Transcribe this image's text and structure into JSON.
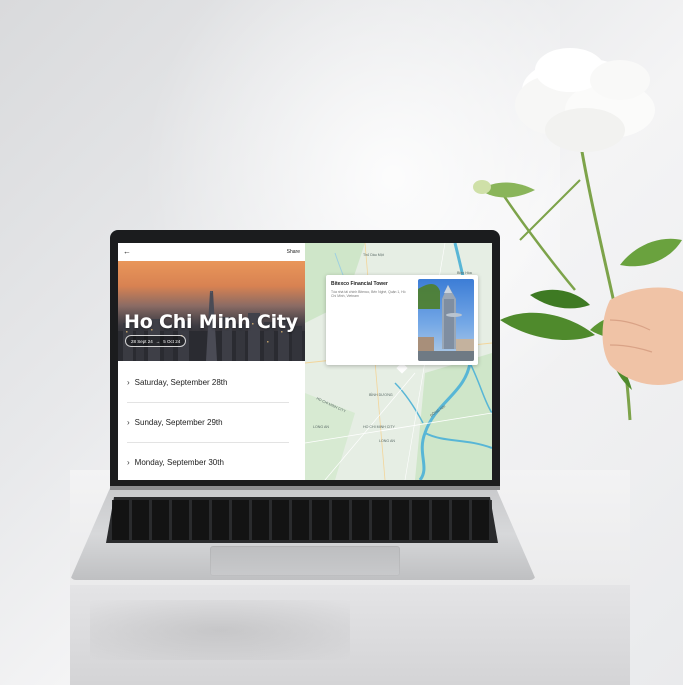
{
  "app": {
    "back_icon": "arrow-left-icon",
    "share_label": "Share",
    "city_title": "Ho Chi Minh City",
    "date_range": {
      "start": "28 Sept 24",
      "arrow": "→",
      "end": "5 Oct 24"
    },
    "days": [
      {
        "label": "Saturday, September 28th"
      },
      {
        "label": "Sunday, September 29th"
      },
      {
        "label": "Monday, September 30th"
      }
    ],
    "map": {
      "labels": {
        "thu_dau_mot": "Thủ Dầu Một",
        "bien_hoa": "Biên Hòa",
        "binh_duong": "BÌNH DƯƠNG",
        "ho_chi_minh_city": "HO CHI MINH CITY",
        "long_an": "LONG AN",
        "dong_nai": "ĐỒNG NAI"
      },
      "popup": {
        "title": "Bitexco Financial Tower",
        "address": "Tòa nhà tài chính Bitexco, Bến Nghé, Quận 1, Hồ Chí Minh, Vietnam"
      }
    }
  },
  "colors": {
    "map_land": "#e6eee4",
    "map_water": "#58b6d6",
    "map_green": "#cfe6c9",
    "hero_sunset": "#e9965a"
  }
}
